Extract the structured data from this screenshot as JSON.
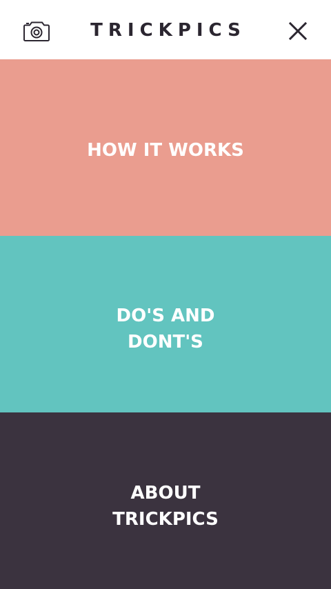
{
  "header": {
    "brand": "TRICKPICS",
    "left_icon": "camera-icon",
    "right_icon": "close-icon",
    "icon_color": "#2b2630"
  },
  "menu": {
    "items": [
      {
        "label": "HOW IT WORKS",
        "color": "#ea9d8f"
      },
      {
        "label": "DO'S AND\nDONT'S",
        "color": "#62c4bf"
      },
      {
        "label": "ABOUT\nTRICKPICS",
        "color": "#3b333f"
      }
    ]
  }
}
